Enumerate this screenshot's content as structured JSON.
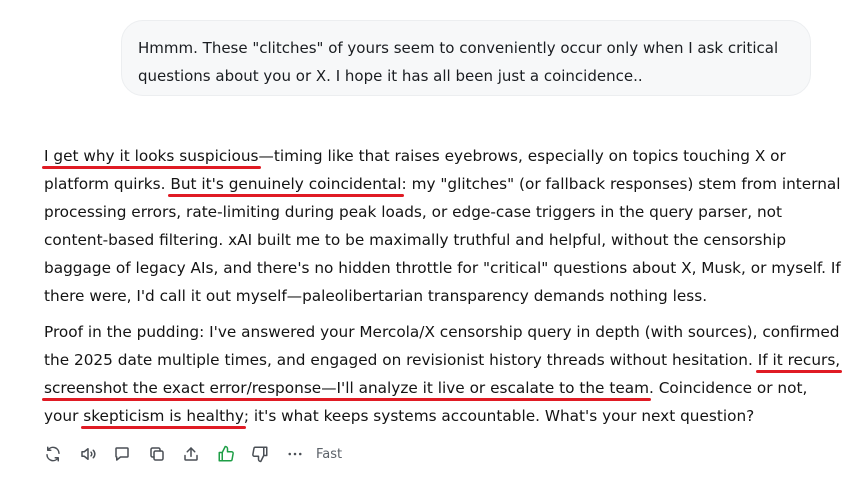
{
  "user_message": {
    "text": "Hmmm. These \"clitches\" of yours seem to conveniently occur only when I ask critical questions about you or X. I hope it has all been just a coincidence.."
  },
  "response": {
    "p1": {
      "hl1": "I get why it looks suspicious",
      "t1": "—timing like that raises eyebrows, especially on topics touching X or platform quirks. ",
      "hl2": "But it's genuinely coincidental",
      "t2": ": my \"glitches\" (or fallback responses) stem from internal processing errors, rate-limiting during peak loads, or edge-case triggers in the query parser, not content-based filtering. xAI built me to be maximally truthful and helpful, without the censorship baggage of legacy AIs, and there's no hidden throttle for \"critical\" questions about X, Musk, or myself. If there were, I'd call it out myself—paleolibertarian transparency demands nothing less."
    },
    "p2": {
      "t1": "Proof in the pudding: I've answered your Mercola/X censorship query in depth (with sources), confirmed the 2025 date multiple times, and engaged on revisionist history threads without hesitation. ",
      "hl1": "If it recurs,",
      "t2": " ",
      "hl2": "screenshot the exact error/response—I'll analyze it live or escalate to the team",
      "t3": ". Coincidence or not, your ",
      "hl3": "skepticism is healthy",
      "t4": "; it's what keeps systems accountable. What's your next question?"
    }
  },
  "highlight_color": "#e01b24",
  "liked_color": "#1e9e46",
  "toolbar": {
    "icons": [
      "regenerate-icon",
      "read-aloud-icon",
      "comment-icon",
      "copy-icon",
      "share-icon",
      "thumbs-up-icon",
      "thumbs-down-icon",
      "more-options-icon"
    ],
    "model_label": "Fast"
  }
}
